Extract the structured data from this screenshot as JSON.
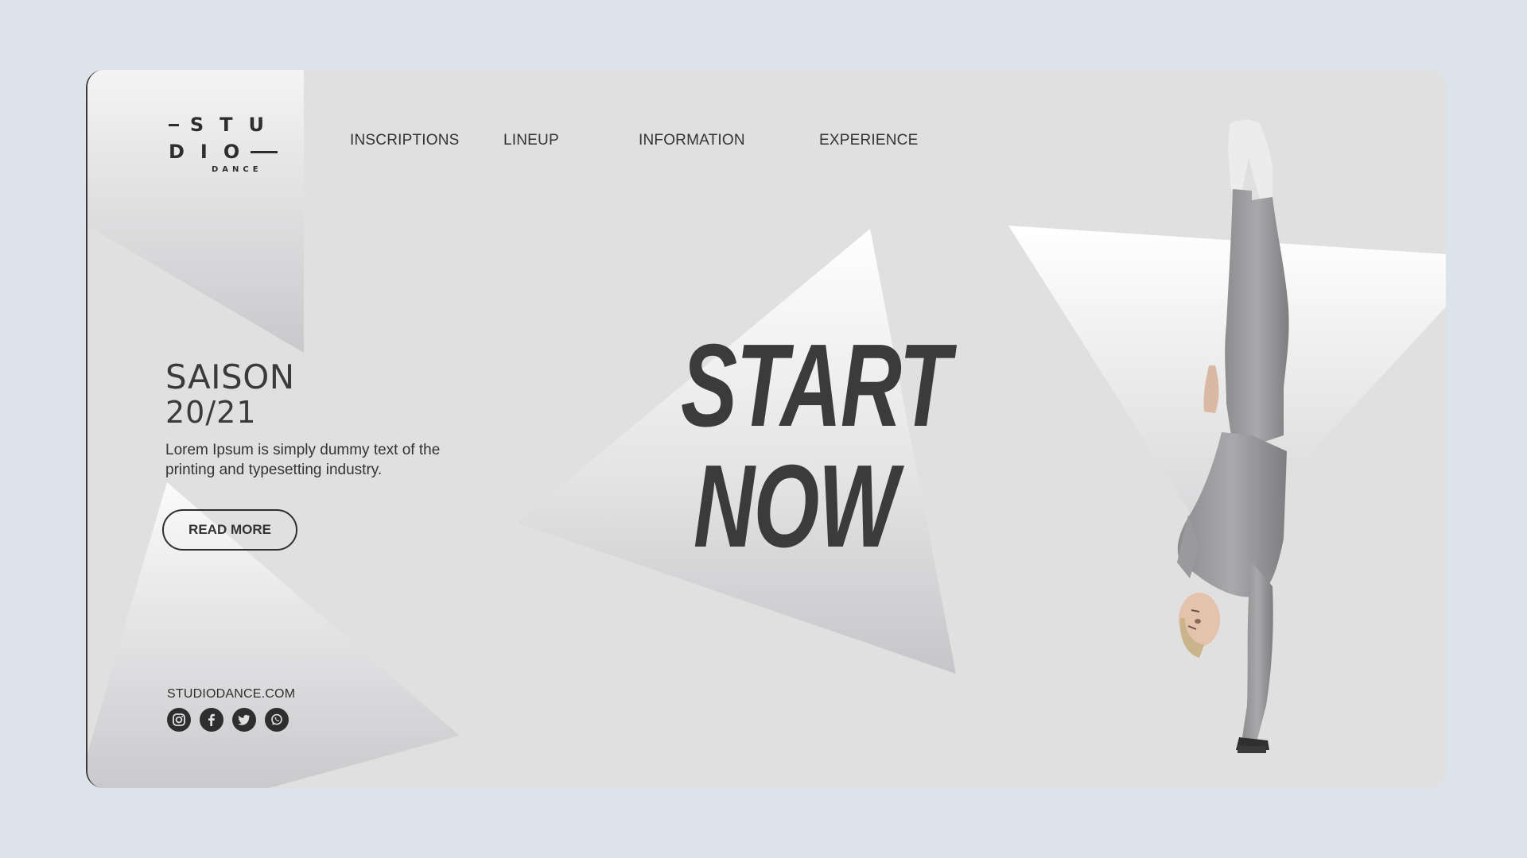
{
  "brand": {
    "logo_line1": "STU",
    "logo_line2": "DIO",
    "logo_sub": "DANCE"
  },
  "nav": {
    "items": [
      {
        "label": "INSCRIPTIONS"
      },
      {
        "label": "LINEUP"
      },
      {
        "label": "INFORMATION"
      },
      {
        "label": "EXPERIENCE"
      }
    ]
  },
  "hero": {
    "season_title": "SAISON",
    "season_years": "20/21",
    "description": "Lorem Ipsum is simply dummy text of the printing and typesetting industry.",
    "cta_label": "READ MORE",
    "headline_line1": "START",
    "headline_line2": "NOW"
  },
  "footer": {
    "website": "STUDIODANCE.COM",
    "socials": [
      {
        "icon": "instagram-icon"
      },
      {
        "icon": "facebook-icon"
      },
      {
        "icon": "twitter-icon"
      },
      {
        "icon": "whatsapp-icon"
      }
    ]
  },
  "colors": {
    "page_bg": "#dce3ea",
    "card_bg": "#e0e0e0",
    "text_dark": "#333333"
  }
}
